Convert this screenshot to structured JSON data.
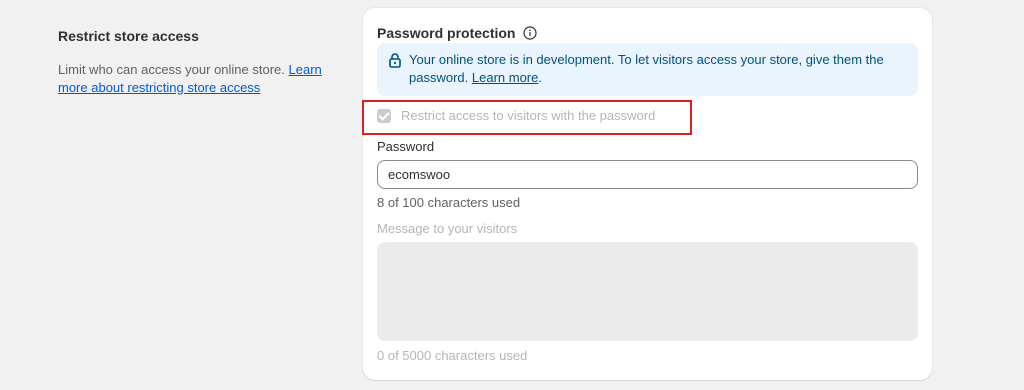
{
  "section": {
    "title": "Restrict store access",
    "description": "Limit who can access your online store.",
    "learn_more": "Learn more about restricting store access"
  },
  "card": {
    "title": "Password protection",
    "banner": {
      "text": "Your online store is in development. To let visitors access your store, give them the password.",
      "link": "Learn more",
      "color": "#eaf4ff"
    },
    "restrict_checkbox": {
      "label": "Restrict access to visitors with the password",
      "checked": true,
      "disabled": true
    },
    "password": {
      "label": "Password",
      "value": "ecomswoo",
      "help": "8 of 100 characters used"
    },
    "message": {
      "label": "Message to your visitors",
      "value": "",
      "help": "0 of 5000 characters used"
    }
  },
  "highlight_color": "#e01e1e",
  "icons": {
    "info": "info-icon",
    "lock": "lock-icon"
  }
}
